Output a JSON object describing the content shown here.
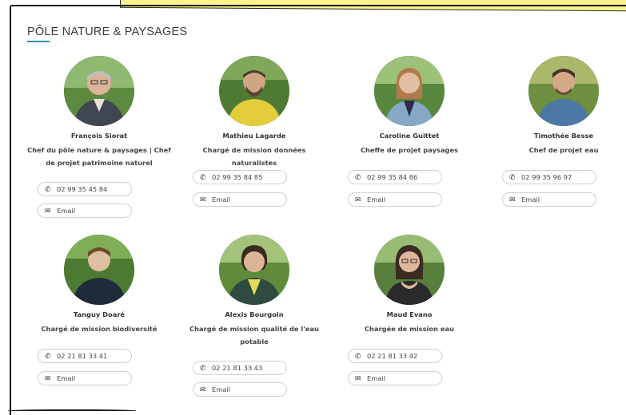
{
  "section": {
    "title": "PÔLE NATURE & PAYSAGES"
  },
  "email_label": "Email",
  "people": [
    {
      "name": "François Siorat",
      "role": "Chef du pôle nature & paysages | Chef de projet patrimoine naturel",
      "phone": "02 99 35 45 84"
    },
    {
      "name": "Mathieu Lagarde",
      "role": "Chargé de mission données naturalistes",
      "phone": "02 99 35 84 85"
    },
    {
      "name": "Caroline Guittet",
      "role": "Cheffe de projet paysages",
      "phone": "02 99 35 84 86"
    },
    {
      "name": "Timothée Besse",
      "role": "Chef de projet eau",
      "phone": "02 99 35 96 97"
    },
    {
      "name": "Tanguy Doaré",
      "role": "Chargé de mission biodiversité",
      "phone": "02 21 81 33 41"
    },
    {
      "name": "Alexis Bourgoin",
      "role": "Chargé de mission qualité de l'eau potable",
      "phone": "02 21 81 33 43"
    },
    {
      "name": "Maud Evano",
      "role": "Chargée de mission eau",
      "phone": "02 21 81 33 42"
    }
  ],
  "colors": {
    "accent_underline": "#2a8fb0",
    "highlight": "#fbf48c"
  },
  "icons": {
    "phone": "phone-icon",
    "email": "envelope-icon"
  }
}
